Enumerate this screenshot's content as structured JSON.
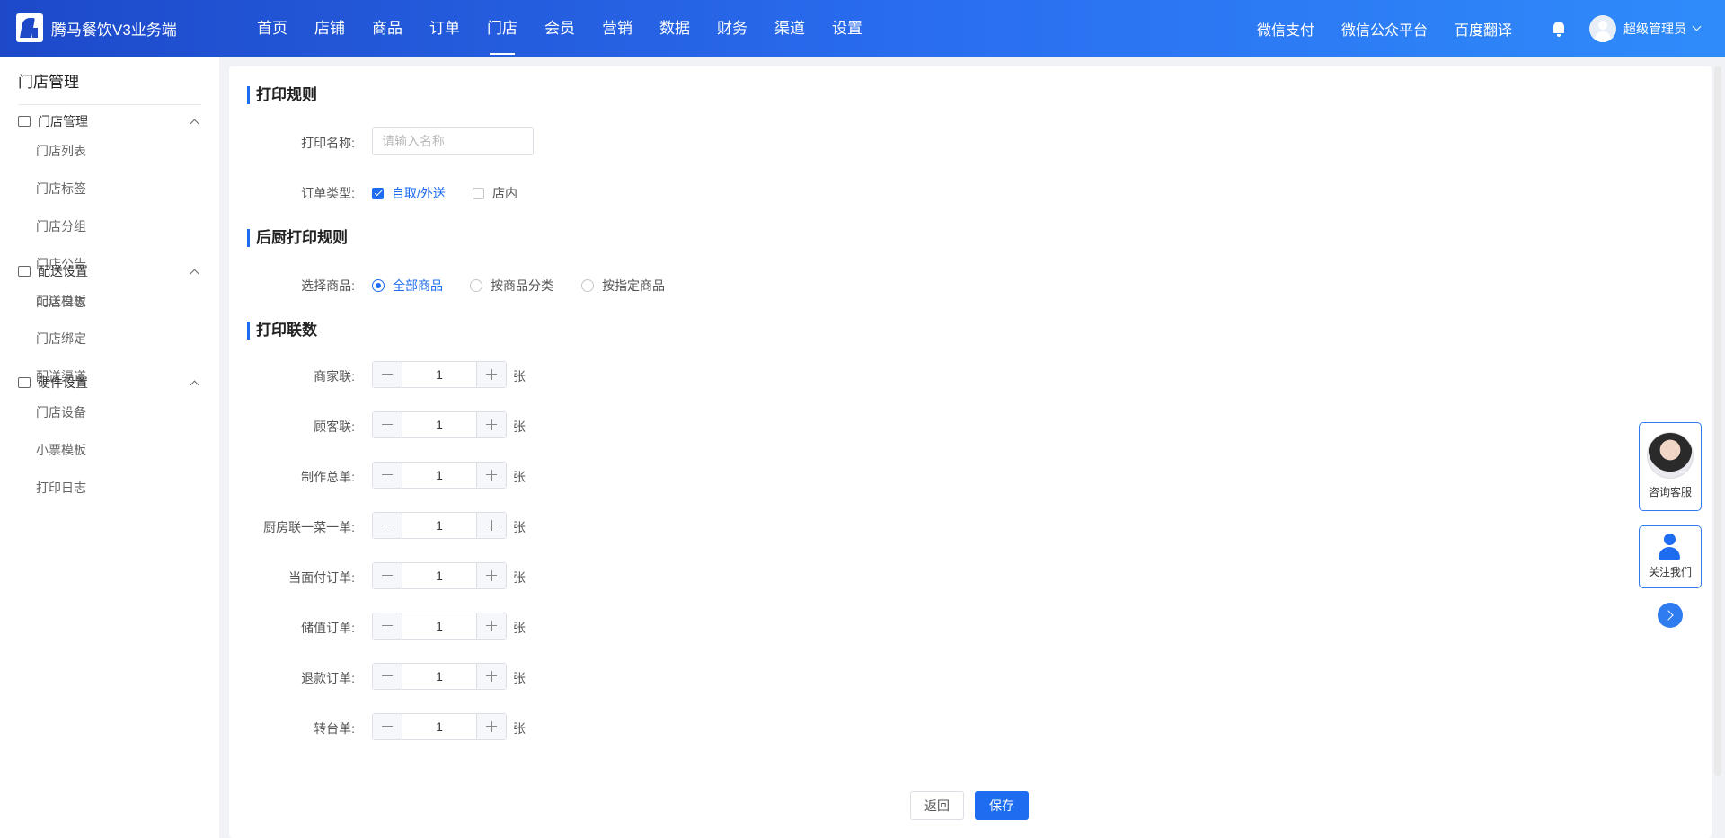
{
  "app": {
    "title": "腾马餐饮V3业务端"
  },
  "nav": [
    "首页",
    "店铺",
    "商品",
    "订单",
    "门店",
    "会员",
    "营销",
    "数据",
    "财务",
    "渠道",
    "设置"
  ],
  "top_links": [
    "微信支付",
    "微信公众平台",
    "百度翻译"
  ],
  "user": {
    "name": "超级管理员"
  },
  "sidebar": {
    "title": "门店管理",
    "groups": [
      {
        "label": "门店管理",
        "items": [
          "门店列表",
          "门店标签",
          "门店分组",
          "门店公告",
          "门店日志"
        ]
      },
      {
        "label": "配送设置",
        "items": [
          "配送模板",
          "门店绑定",
          "配送渠道"
        ]
      },
      {
        "label": "硬件设置",
        "items": [
          "门店设备",
          "小票模板",
          "打印日志"
        ]
      }
    ]
  },
  "form": {
    "section1": "打印规则",
    "print_name_label": "打印名称:",
    "print_name_placeholder": "请输入名称",
    "order_type_label": "订单类型:",
    "order_types": [
      {
        "label": "自取/外送",
        "checked": true
      },
      {
        "label": "店内",
        "checked": false
      }
    ],
    "section2": "后厨打印规则",
    "goods_label": "选择商品:",
    "goods_options": [
      {
        "label": "全部商品",
        "selected": true
      },
      {
        "label": "按商品分类",
        "selected": false
      },
      {
        "label": "按指定商品",
        "selected": false
      }
    ],
    "section3": "打印联数",
    "unit": "张",
    "copies": [
      {
        "label": "商家联:",
        "value": "1"
      },
      {
        "label": "顾客联:",
        "value": "1"
      },
      {
        "label": "制作总单:",
        "value": "1"
      },
      {
        "label": "厨房联一菜一单:",
        "value": "1"
      },
      {
        "label": "当面付订单:",
        "value": "1"
      },
      {
        "label": "储值订单:",
        "value": "1"
      },
      {
        "label": "退款订单:",
        "value": "1"
      },
      {
        "label": "转台单:",
        "value": "1"
      }
    ],
    "back_label": "返回",
    "save_label": "保存"
  },
  "float": {
    "consult_label": "咨询客服",
    "follow_label": "关注我们"
  },
  "colors": {
    "primary": "#1e6cf0",
    "nav_start": "#1d49c9",
    "nav_end": "#2f8bfa"
  }
}
